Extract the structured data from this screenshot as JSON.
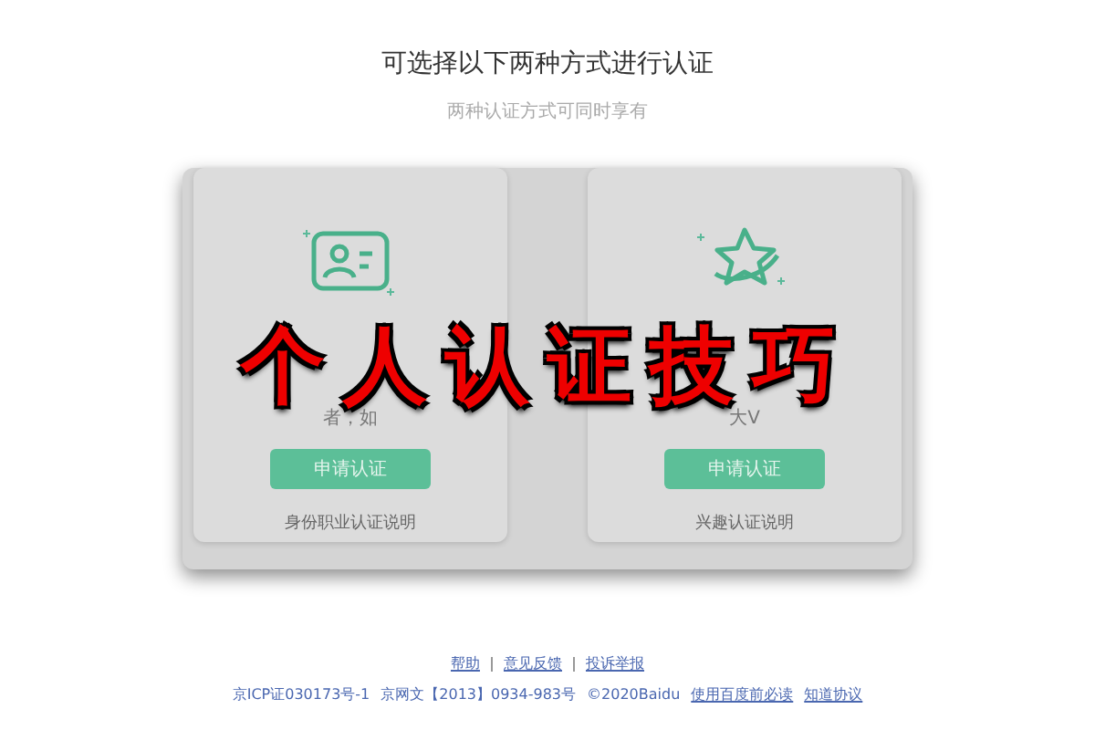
{
  "header": {
    "title": "可选择以下两种方式进行认证",
    "subtitle": "两种认证方式可同时享有"
  },
  "cards": [
    {
      "description": "者，如",
      "button": "申请认证",
      "link": "身份职业认证说明"
    },
    {
      "description": "大V",
      "button": "申请认证",
      "link": "兴趣认证说明"
    }
  ],
  "overlay_title": "个人认证技巧",
  "footer": {
    "links": [
      "帮助",
      "意见反馈",
      "投诉举报"
    ],
    "legal": [
      "京ICP证030173号-1",
      "京网文【2013】0934-983号",
      "©2020Baidu"
    ],
    "legal_links": [
      "使用百度前必读",
      "知道协议"
    ]
  }
}
